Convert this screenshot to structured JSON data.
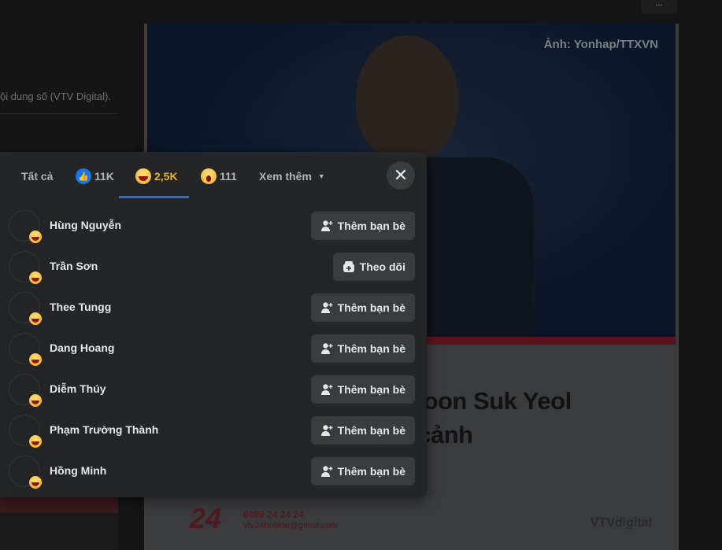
{
  "background": {
    "left_text": "ội dung số (VTV Digital).",
    "photo_credit": "Ảnh: Yonhap/TTXVN",
    "headline_line1": "ốc Yoon Suk Yeol",
    "headline_line2": "uất cảnh",
    "logo": "24",
    "phone": "0889 24 24 24",
    "email": "vtv24hotline@gmail.com",
    "brand": "VTVdigital"
  },
  "dialog": {
    "tabs": [
      {
        "label": "Tất cả",
        "icon": ""
      },
      {
        "label": "11K",
        "icon": "like-icon"
      },
      {
        "label": "2,5K",
        "icon": "haha-icon",
        "active": true
      },
      {
        "label": "111",
        "icon": "wow-icon"
      },
      {
        "label": "Xem thêm",
        "icon": "caret-down-icon"
      }
    ],
    "accent": "#2d6ad8",
    "active_color": "#e7b12b",
    "people": [
      {
        "name": "Hùng Nguyễn",
        "action": "Thêm bạn bè",
        "action_icon": "add-friend-icon"
      },
      {
        "name": "Trần Sơn",
        "action": "Theo dõi",
        "action_icon": "follow-icon"
      },
      {
        "name": "Thee Tungg",
        "action": "Thêm bạn bè",
        "action_icon": "add-friend-icon"
      },
      {
        "name": "Dang Hoang",
        "action": "Thêm bạn bè",
        "action_icon": "add-friend-icon"
      },
      {
        "name": "Diễm Thúy",
        "action": "Thêm bạn bè",
        "action_icon": "add-friend-icon"
      },
      {
        "name": "Phạm Trường Thành",
        "action": "Thêm bạn bè",
        "action_icon": "add-friend-icon"
      },
      {
        "name": "Hồng Minh",
        "action": "Thêm bạn bè",
        "action_icon": "add-friend-icon"
      }
    ]
  }
}
